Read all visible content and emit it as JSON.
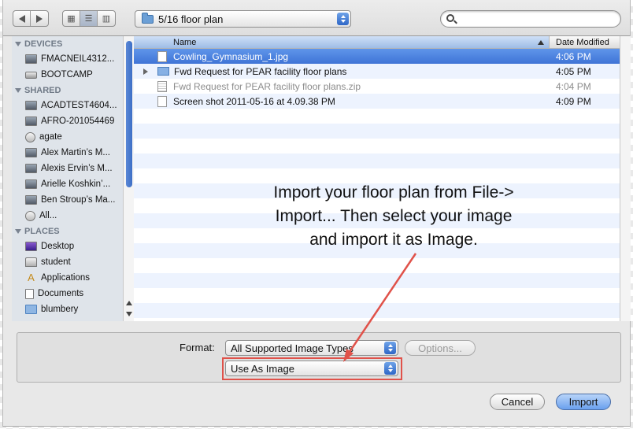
{
  "toolbar": {
    "path": "5/16 floor plan",
    "search_placeholder": ""
  },
  "sidebar": {
    "sections": [
      {
        "title": "DEVICES",
        "items": [
          {
            "label": "FMACNEIL4312...",
            "icon": "imac-icon"
          },
          {
            "label": "BOOTCAMP",
            "icon": "disk-icon"
          }
        ]
      },
      {
        "title": "SHARED",
        "items": [
          {
            "label": "ACADTEST4604...",
            "icon": "imac-icon"
          },
          {
            "label": "AFRO-201054469",
            "icon": "imac-icon"
          },
          {
            "label": "agate",
            "icon": "network-icon"
          },
          {
            "label": "Alex Martin’s M...",
            "icon": "laptop-icon"
          },
          {
            "label": "Alexis Ervin’s M...",
            "icon": "laptop-icon"
          },
          {
            "label": "Arielle Koshkin’...",
            "icon": "laptop-icon"
          },
          {
            "label": "Ben Stroup’s Ma...",
            "icon": "laptop-icon"
          },
          {
            "label": "All...",
            "icon": "network-icon"
          }
        ]
      },
      {
        "title": "PLACES",
        "items": [
          {
            "label": "Desktop",
            "icon": "desktop-icon"
          },
          {
            "label": "student",
            "icon": "home-icon"
          },
          {
            "label": "Applications",
            "icon": "applications-icon"
          },
          {
            "label": "Documents",
            "icon": "documents-icon"
          },
          {
            "label": "blumbery",
            "icon": "folder-icon"
          }
        ]
      }
    ]
  },
  "list": {
    "col_name": "Name",
    "col_date": "Date Modified",
    "rows": [
      {
        "name": "Cowling_Gymnasium_1.jpg",
        "date": "4:06 PM"
      },
      {
        "name": "Fwd Request for PEAR facility floor plans",
        "date": "4:05 PM"
      },
      {
        "name": "Fwd Request for PEAR facility floor plans.zip",
        "date": "4:04 PM"
      },
      {
        "name": "Screen shot 2011-05-16 at 4.09.38 PM",
        "date": "4:09 PM"
      }
    ]
  },
  "annotation": {
    "line1": "Import your floor plan from File->",
    "line2": "Import... Then select your image",
    "line3": "and import it as Image."
  },
  "options": {
    "format_label": "Format:",
    "format_value": "All Supported Image Types",
    "options_button": "Options...",
    "use_as_value": "Use As Image"
  },
  "buttons": {
    "cancel": "Cancel",
    "import": "Import"
  },
  "colors": {
    "selection": "#3f74d6",
    "highlight_box": "#e0524a",
    "annotation_arrow": "#e0524a"
  }
}
